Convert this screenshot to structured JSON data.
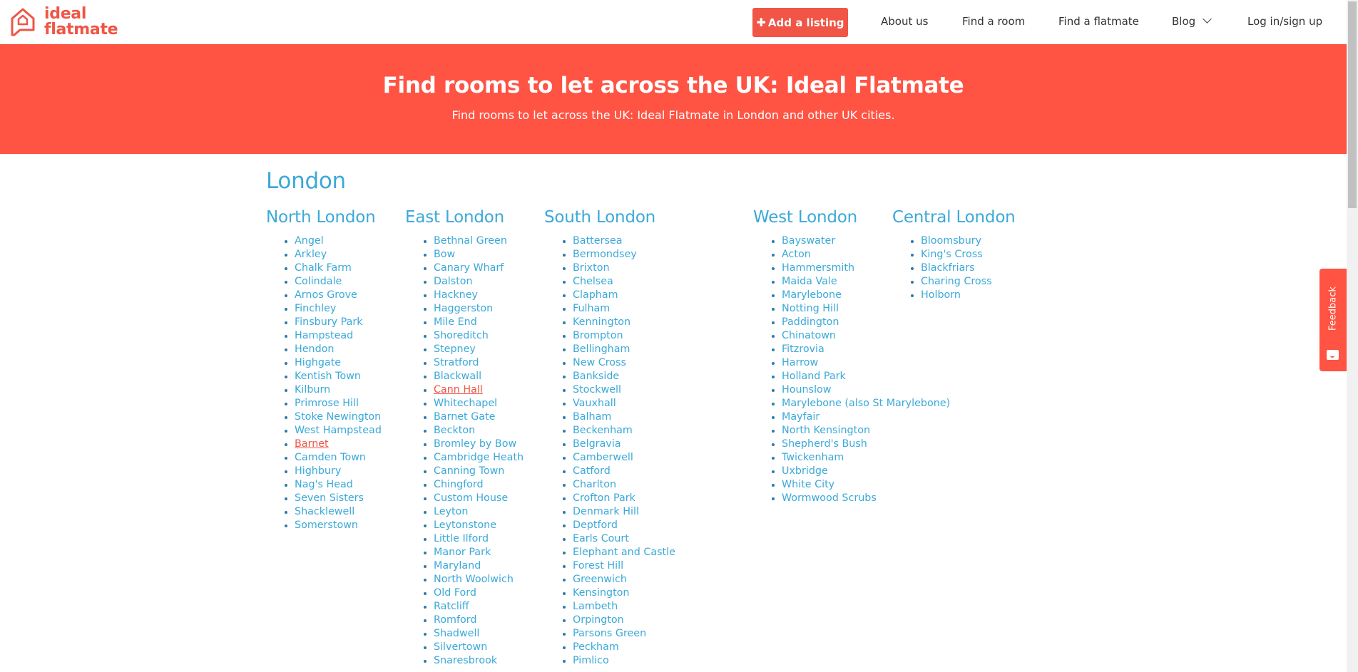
{
  "header": {
    "logo_line1": "ideal",
    "logo_line2": "flatmate",
    "add_listing": "Add a listing",
    "nav": [
      "About us",
      "Find a room",
      "Find a flatmate",
      "Blog",
      "Log in/sign up"
    ]
  },
  "hero": {
    "title": "Find rooms to let across the UK: Ideal Flatmate",
    "subtitle": "Find rooms to let across the UK: Ideal Flatmate in London and other UK cities."
  },
  "city": "London",
  "columns": [
    {
      "title": "North London",
      "items": [
        "Angel",
        "Arkley",
        "Chalk Farm",
        "Colindale",
        "Arnos Grove",
        "Finchley",
        "Finsbury Park",
        "Hampstead",
        "Hendon",
        "Highgate",
        "Kentish Town",
        "Kilburn",
        "Primrose Hill",
        "Stoke Newington",
        "West Hampstead",
        "Barnet",
        "Camden Town",
        "Highbury",
        "Nag's Head",
        "Seven Sisters",
        "Shacklewell",
        "Somerstown"
      ],
      "visited": [
        "Barnet"
      ]
    },
    {
      "title": "East London",
      "items": [
        "Bethnal Green",
        "Bow",
        "Canary Wharf",
        "Dalston",
        "Hackney",
        "Haggerston",
        "Mile End",
        "Shoreditch",
        "Stepney",
        "Stratford",
        "Blackwall",
        "Cann Hall",
        "Whitechapel",
        "Barnet Gate",
        "Beckton",
        "Bromley by Bow",
        "Cambridge Heath",
        "Canning Town",
        "Chingford",
        "Custom House",
        "Leyton",
        "Leytonstone",
        "Little Ilford",
        "Manor Park",
        "Maryland",
        "North Woolwich",
        "Old Ford",
        "Ratcliff",
        "Romford",
        "Shadwell",
        "Silvertown",
        "Snaresbrook"
      ],
      "visited": [
        "Cann Hall"
      ]
    },
    {
      "title": "South London",
      "items": [
        "Battersea",
        "Bermondsey",
        "Brixton",
        "Chelsea",
        "Clapham",
        "Fulham",
        "Kennington",
        "Brompton",
        "Bellingham",
        "New Cross",
        "Bankside",
        "Stockwell",
        "Vauxhall",
        "Balham",
        "Beckenham",
        "Belgravia",
        "Camberwell",
        "Catford",
        "Charlton",
        "Crofton Park",
        "Denmark Hill",
        "Deptford",
        "Earls Court",
        "Elephant and Castle",
        "Forest Hill",
        "Greenwich",
        "Kensington",
        "Lambeth",
        "Orpington",
        "Parsons Green",
        "Peckham",
        "Pimlico"
      ],
      "visited": []
    },
    {
      "title": "West London",
      "items": [
        "Bayswater",
        "Acton",
        "Hammersmith",
        "Maida Vale",
        "Marylebone",
        "Notting Hill",
        "Paddington",
        "Chinatown",
        "Fitzrovia",
        "Harrow",
        "Holland Park",
        "Hounslow",
        "Marylebone (also St Marylebone)",
        "Mayfair",
        "North Kensington",
        "Shepherd's Bush",
        "Twickenham",
        "Uxbridge",
        "White City",
        "Wormwood Scrubs"
      ],
      "visited": []
    },
    {
      "title": "Central London",
      "items": [
        "Bloomsbury",
        "King's Cross",
        "Blackfriars",
        "Charing Cross",
        "Holborn"
      ],
      "visited": []
    }
  ],
  "feedback": "Feedback",
  "colors": {
    "brand": "#ff5343",
    "link": "#3ba9d8",
    "visited": "#f05545"
  }
}
